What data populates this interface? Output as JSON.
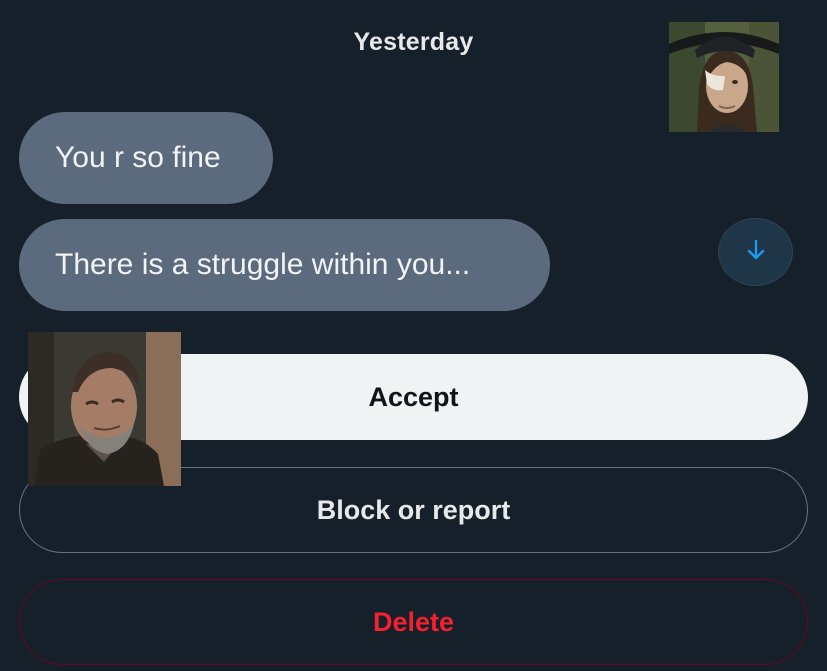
{
  "chat": {
    "date_separator": "Yesterday",
    "messages": [
      {
        "text": "You r so fine"
      },
      {
        "text": "There is a struggle within you..."
      }
    ]
  },
  "icons": {
    "scroll_down": "arrow-down-icon"
  },
  "actions": {
    "accept_label": "Accept",
    "block_label": "Block or report",
    "delete_label": "Delete"
  },
  "colors": {
    "background": "#15202b",
    "bubble": "#5b6b7d",
    "accent": "#1d9bf0",
    "danger": "#f4212e"
  }
}
